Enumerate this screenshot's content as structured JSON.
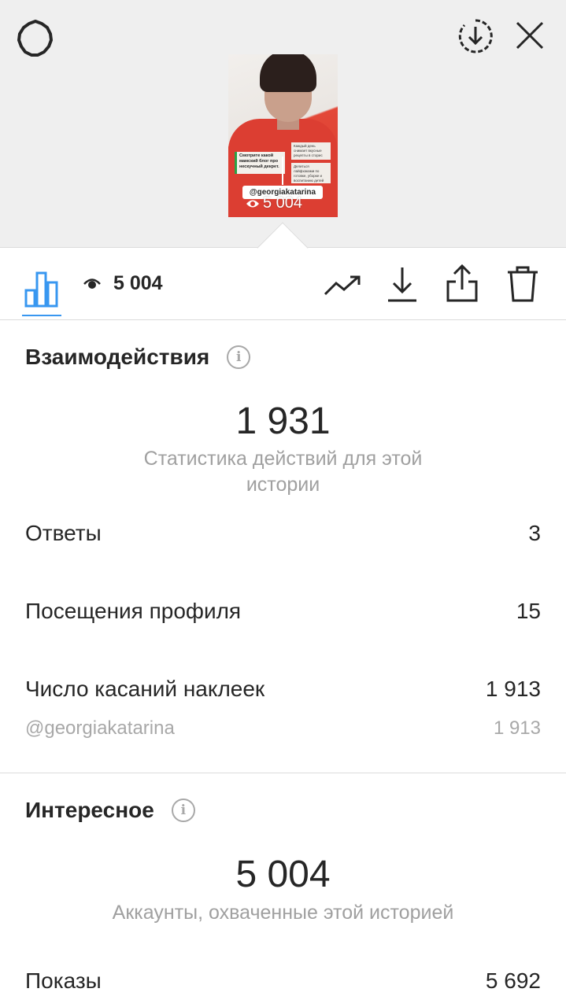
{
  "top_bar": {
    "settings_icon": "gear-icon",
    "download_icon": "download-circle-icon",
    "close_icon": "close-icon"
  },
  "story_preview": {
    "mention": "@georgiakatarina",
    "views": "5 004",
    "card_left_text": "Смотрите какой мамский блог про нескучный декрет.",
    "card_right_1": "Каждый день снимает вкусные рецепты в сторис",
    "card_right_2": "Делиться лайфхаками по готовке, уборке и воспитанию детей"
  },
  "toolbar": {
    "views": "5 004",
    "icons": [
      "bar-chart-icon",
      "eye-icon",
      "trend-icon",
      "download-icon",
      "share-icon",
      "trash-icon"
    ]
  },
  "interactions": {
    "title": "Взаимодействия",
    "total": "1 931",
    "caption": "Статистика действий для этой истории",
    "rows": [
      {
        "label": "Ответы",
        "value": "3"
      },
      {
        "label": "Посещения профиля",
        "value": "15"
      },
      {
        "label": "Число касаний наклеек",
        "value": "1 913"
      }
    ],
    "sub_row": {
      "label": "@georgiakatarina",
      "value": "1 913"
    }
  },
  "discovery": {
    "title": "Интересное",
    "total": "5 004",
    "caption": "Аккаунты, охваченные этой историей",
    "rows": [
      {
        "label": "Показы",
        "value": "5 692"
      }
    ]
  },
  "colors": {
    "accent": "#3897f0",
    "text": "#262626",
    "muted": "#a0a0a0",
    "top_bg": "#efefef"
  }
}
